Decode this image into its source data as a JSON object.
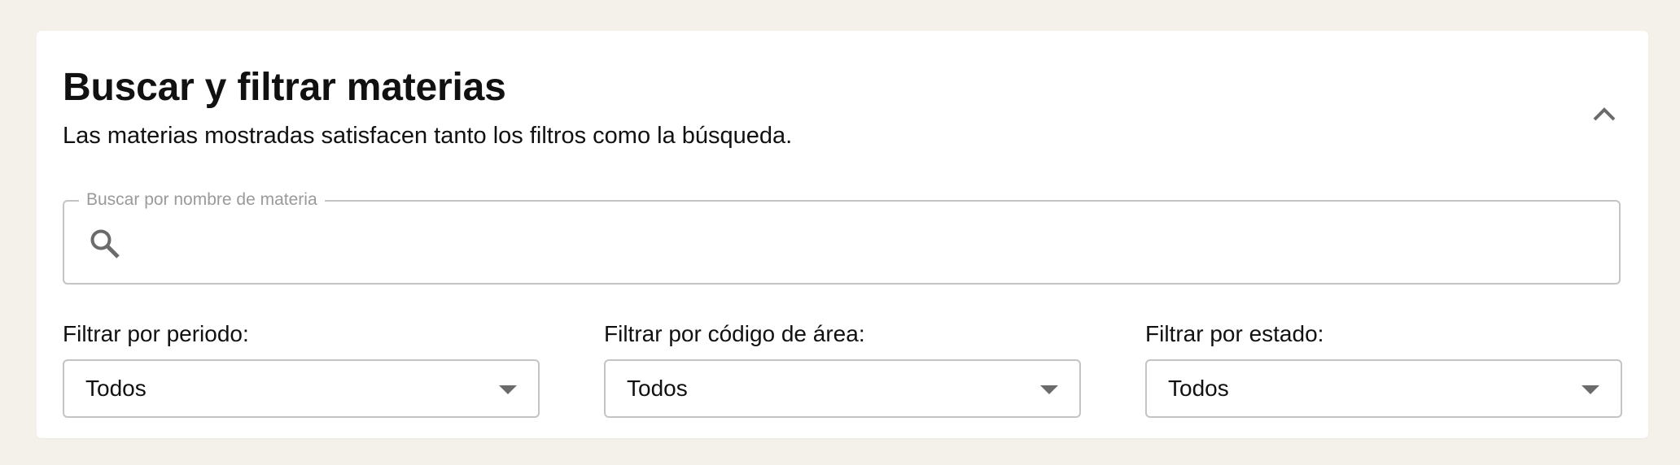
{
  "header": {
    "title": "Buscar y filtrar materias",
    "subtitle": "Las materias mostradas satisfacen tanto los filtros como la búsqueda.",
    "collapse_icon": "chevron-up-icon"
  },
  "search": {
    "label": "Buscar por nombre de materia",
    "value": "",
    "icon": "search-icon"
  },
  "filters": [
    {
      "label": "Filtrar por periodo:",
      "value": "Todos",
      "icon": "dropdown-caret-icon"
    },
    {
      "label": "Filtrar por código de área:",
      "value": "Todos",
      "icon": "dropdown-caret-icon"
    },
    {
      "label": "Filtrar por estado:",
      "value": "Todos",
      "icon": "dropdown-caret-icon"
    }
  ],
  "colors": {
    "page_background": "#f4f0ea",
    "panel_background": "#ffffff",
    "border": "#c4c4c4",
    "icon": "#6b6b6b",
    "legend_text": "#9a9a9a"
  }
}
